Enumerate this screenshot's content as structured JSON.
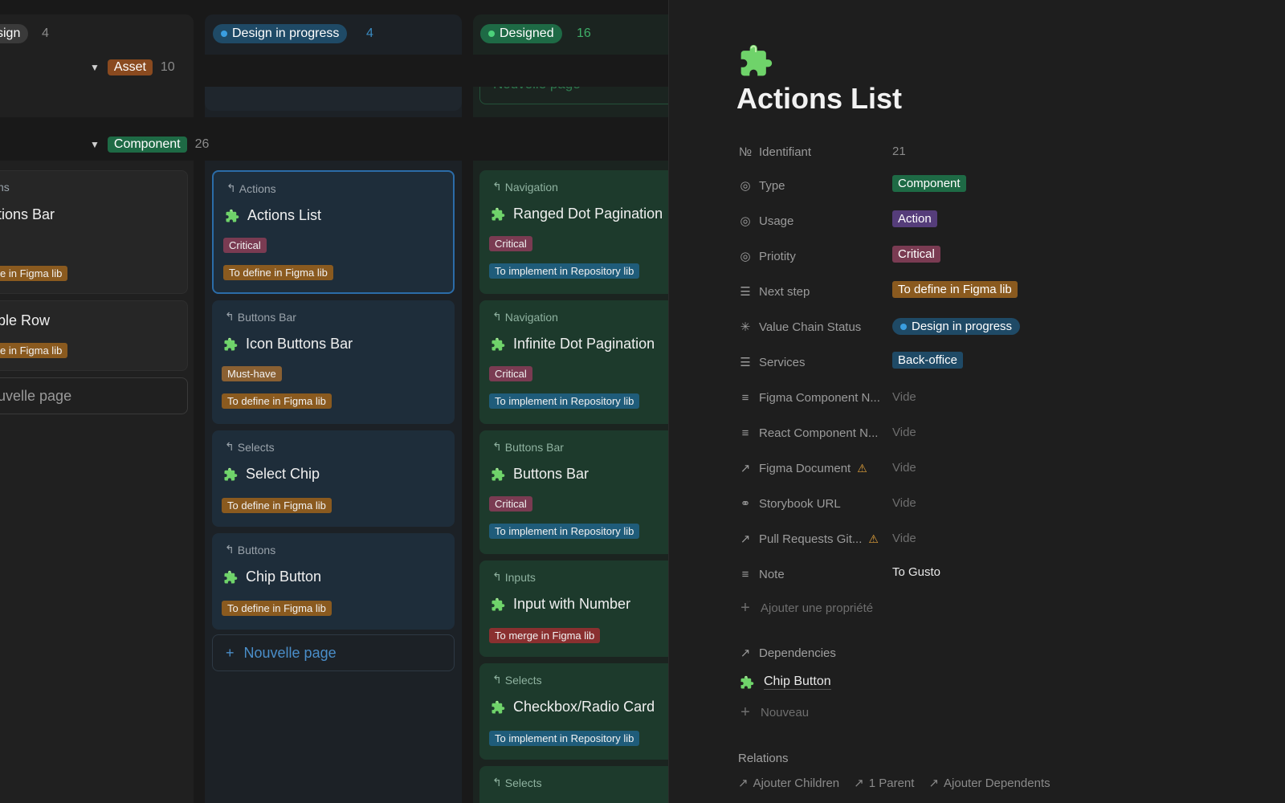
{
  "board": {
    "columns": [
      {
        "label": "sign",
        "count": "4"
      },
      {
        "label": "Design in progress",
        "count": "4"
      },
      {
        "label": "Designed",
        "count": "16"
      }
    ],
    "groups": [
      {
        "label": "Asset",
        "count": "10"
      },
      {
        "label": "Component",
        "count": "26"
      }
    ],
    "left_cards": [
      {
        "parent": "ns",
        "title": "tions Bar",
        "tag": "e in Figma lib"
      },
      {
        "title": "ble Row",
        "tag": "e in Figma lib"
      }
    ],
    "left_new_page": "uvelle page",
    "right_new_page_partial": "Nouvelle page",
    "mid_cards": [
      {
        "parent": "Actions",
        "title": "Actions List",
        "priority": "Critical",
        "step": "To define in Figma lib"
      },
      {
        "parent": "Buttons Bar",
        "title": "Icon Buttons Bar",
        "priority": "Must-have",
        "step": "To define in Figma lib"
      },
      {
        "parent": "Selects",
        "title": "Select Chip",
        "step": "To define in Figma lib"
      },
      {
        "parent": "Buttons",
        "title": "Chip Button",
        "step": "To define in Figma lib"
      }
    ],
    "mid_new_page": "Nouvelle page",
    "right_cards": [
      {
        "parent": "Navigation",
        "title": "Ranged Dot Pagination",
        "priority": "Critical",
        "step": "To implement in Repository lib"
      },
      {
        "parent": "Navigation",
        "title": "Infinite Dot Pagination",
        "priority": "Critical",
        "step": "To implement in Repository lib"
      },
      {
        "parent": "Buttons Bar",
        "title": "Buttons Bar",
        "priority": "Critical",
        "step": "To implement in Repository lib"
      },
      {
        "parent": "Inputs",
        "title": "Input with Number",
        "step": "To merge in Figma lib"
      },
      {
        "parent": "Selects",
        "title": "Checkbox/Radio Card",
        "step": "To implement in Repository lib"
      },
      {
        "parent": "Selects"
      }
    ]
  },
  "panel": {
    "icon": "puzzle-icon",
    "title": "Actions List",
    "props": [
      {
        "label": "Identifiant",
        "icon_text": "№",
        "value": "21"
      },
      {
        "label": "Type",
        "value": "Component"
      },
      {
        "label": "Usage",
        "value": "Action"
      },
      {
        "label": "Priotity",
        "value": "Critical"
      },
      {
        "label": "Next step",
        "value": "To define in Figma lib"
      },
      {
        "label": "Value Chain Status",
        "value": "Design in progress"
      },
      {
        "label": "Services",
        "value": "Back-office"
      },
      {
        "label": "Figma Component N...",
        "value": "Vide"
      },
      {
        "label": "React Component N...",
        "value": "Vide"
      },
      {
        "label": "Figma Document",
        "value": "Vide"
      },
      {
        "label": "Storybook URL",
        "value": "Vide"
      },
      {
        "label": "Pull Requests Git...",
        "value": "Vide"
      },
      {
        "label": "Note",
        "value": "To Gusto"
      }
    ],
    "add_property": "Ajouter une propriété",
    "dependencies_label": "Dependencies",
    "dependency_item": "Chip Button",
    "new_label": "Nouveau",
    "relations_label": "Relations",
    "relations": [
      "Ajouter Children",
      "1 Parent",
      "Ajouter Dependents"
    ]
  },
  "colors": {
    "background": "#191919",
    "panel": "#1e1e1e",
    "accent_blue": "#2b6ca8",
    "component_green": "#1e6a45"
  }
}
